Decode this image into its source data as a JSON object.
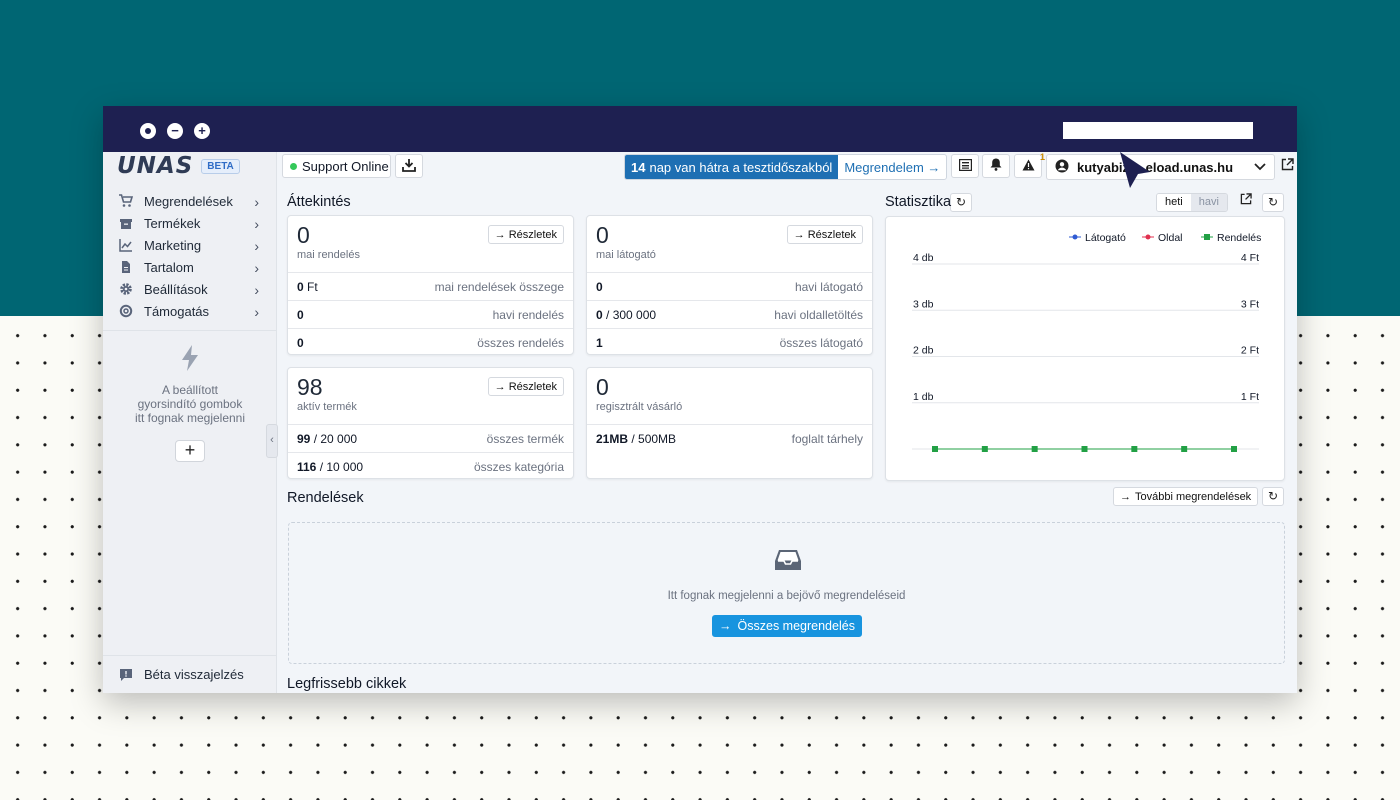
{
  "colors": {
    "teal_bg": "#006673",
    "titlebar": "#1e2051",
    "accent": "#1894df",
    "trial_blue": "#1e6fb3",
    "online": "#34c85a",
    "chart_green": "#22a045"
  },
  "window": {
    "controls": [
      "close",
      "minimize",
      "maximize"
    ]
  },
  "brand": {
    "logo": "UNAS",
    "badge": "BETA"
  },
  "sidebar": {
    "items": [
      {
        "label": "Megrendelések",
        "icon": "cart-icon"
      },
      {
        "label": "Termékek",
        "icon": "box-icon"
      },
      {
        "label": "Marketing",
        "icon": "chart-line-icon"
      },
      {
        "label": "Tartalom",
        "icon": "document-icon"
      },
      {
        "label": "Beállítások",
        "icon": "gear-icon"
      },
      {
        "label": "Támogatás",
        "icon": "lifebuoy-icon"
      }
    ],
    "quick_text": [
      "A beállított",
      "gyorsindító gombok",
      "itt fognak megjelenni"
    ],
    "add_label": "+",
    "feedback_label": "Béta visszajelzés"
  },
  "topbar": {
    "support_label": "Support Online",
    "trial_days": "14",
    "trial_text": "nap van hátra a tesztidőszakból",
    "order_label": "Megrendelem →",
    "alert_count": "1",
    "user_domain": "kutyabiz… eload.unas.hu"
  },
  "overview": {
    "title": "Áttekintés",
    "details_label": "Részletek",
    "cards": [
      {
        "big": "0",
        "sub": "mai rendelés",
        "rows": [
          {
            "val": "0",
            "val2": " Ft",
            "label": "mai rendelések összege"
          },
          {
            "val": "0",
            "val2": "",
            "label": "havi rendelés"
          },
          {
            "val": "0",
            "val2": "",
            "label": "összes rendelés"
          }
        ]
      },
      {
        "big": "0",
        "sub": "mai látogató",
        "rows": [
          {
            "val": "0",
            "val2": "",
            "label": "havi látogató"
          },
          {
            "val": "0",
            "val2": " / 300 000",
            "label": "havi oldalletöltés"
          },
          {
            "val": "1",
            "val2": "",
            "label": "összes látogató"
          }
        ]
      },
      {
        "big": "98",
        "sub": "aktív termék",
        "rows": [
          {
            "val": "99",
            "val2": " / 20 000",
            "label": "összes termék"
          },
          {
            "val": "116",
            "val2": " / 10 000",
            "label": "összes kategória"
          }
        ]
      },
      {
        "big": "0",
        "sub": "regisztrált vásárló",
        "rows": [
          {
            "val": "21MB",
            "val2": " / 500MB",
            "label": "foglalt tárhely"
          }
        ]
      }
    ]
  },
  "stats": {
    "title": "Statisztika",
    "period_on": "heti",
    "period_off": "havi"
  },
  "chart_data": {
    "type": "line",
    "legend_position": "top-right",
    "legend": [
      {
        "name": "Látogató",
        "color": "#2f5bd3"
      },
      {
        "name": "Oldal",
        "color": "#e0314f"
      },
      {
        "name": "Rendelés",
        "color": "#22a045"
      }
    ],
    "y_left_ticks": [
      "1 db",
      "2 db",
      "3 db",
      "4 db"
    ],
    "y_right_ticks": [
      "1 Ft",
      "2 Ft",
      "3 Ft",
      "4 Ft"
    ],
    "ylim": [
      0,
      4
    ],
    "grid": true,
    "series": [
      {
        "name": "Rendelés",
        "values": [
          0,
          0,
          0,
          0,
          0,
          0,
          0
        ]
      }
    ]
  },
  "orders": {
    "title": "Rendelések",
    "more_label": "További megrendelések",
    "empty_text": "Itt fognak megjelenni a bejövő megrendeléseid",
    "all_label": "Összes megrendelés"
  },
  "articles": {
    "title": "Legfrissebb cikkek"
  }
}
